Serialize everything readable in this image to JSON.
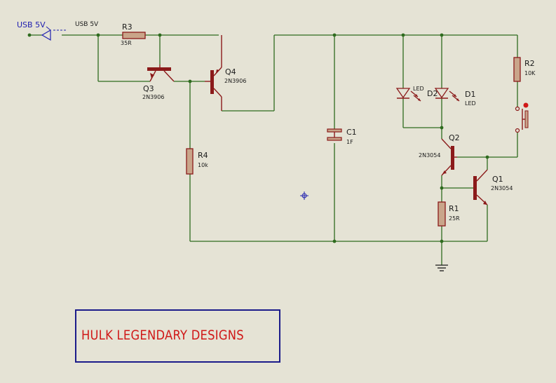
{
  "terminal": {
    "label": "USB 5V"
  },
  "net": {
    "label": "USB 5V"
  },
  "components": {
    "R3": {
      "ref": "R3",
      "value": "35R"
    },
    "Q3": {
      "ref": "Q3",
      "value": "2N3906"
    },
    "Q4": {
      "ref": "Q4",
      "value": "2N3906"
    },
    "R4": {
      "ref": "R4",
      "value": "10k"
    },
    "C1": {
      "ref": "C1",
      "value": "1F"
    },
    "LED2": {
      "ref": "D2",
      "value": "LED"
    },
    "D1": {
      "ref": "D1",
      "value": "LED"
    },
    "R2": {
      "ref": "R2",
      "value": "10K"
    },
    "Q2": {
      "ref": "Q2",
      "value": "2N3054"
    },
    "Q1": {
      "ref": "Q1",
      "value": "2N3054"
    },
    "R1": {
      "ref": "R1",
      "value": "25R"
    }
  },
  "title_block": {
    "text": "HULK LEGENDARY DESIGNS"
  }
}
